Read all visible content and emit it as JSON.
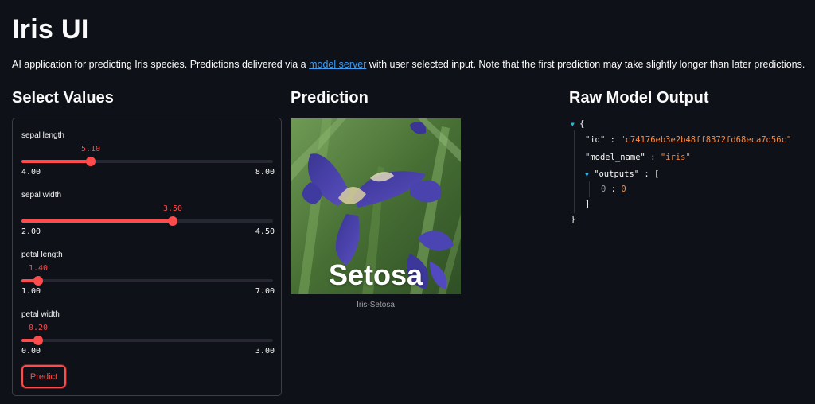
{
  "header": {
    "title": "Iris UI",
    "description_before": "AI application for predicting Iris species. Predictions delivered via a ",
    "description_link": "model server",
    "description_after": " with user selected input. Note that the first prediction may take slightly longer than later predictions."
  },
  "columns": {
    "select_values": "Select Values",
    "prediction": "Prediction",
    "raw_output": "Raw Model Output"
  },
  "sliders": [
    {
      "label": "sepal length",
      "value_text": "5.10",
      "value": 5.1,
      "min_text": "4.00",
      "max_text": "8.00",
      "min": 4.0,
      "max": 8.0
    },
    {
      "label": "sepal width",
      "value_text": "3.50",
      "value": 3.5,
      "min_text": "2.00",
      "max_text": "4.50",
      "min": 2.0,
      "max": 4.5
    },
    {
      "label": "petal length",
      "value_text": "1.40",
      "value": 1.4,
      "min_text": "1.00",
      "max_text": "7.00",
      "min": 1.0,
      "max": 7.0
    },
    {
      "label": "petal width",
      "value_text": "0.20",
      "value": 0.2,
      "min_text": "0.00",
      "max_text": "3.00",
      "min": 0.0,
      "max": 3.0
    }
  ],
  "predict_button": "Predict",
  "prediction": {
    "overlay_text": "Setosa",
    "caption": "Iris-Setosa"
  },
  "raw_output": {
    "open_brace": "{",
    "close_brace": "}",
    "id_key": "\"id\"",
    "id_value": "\"c74176eb3e2b48ff8372fd68eca7d56c\"",
    "model_name_key": "\"model_name\"",
    "model_name_value": "\"iris\"",
    "outputs_key": "\"outputs\"",
    "outputs_open": "[",
    "outputs_close": "]",
    "output_index": "0",
    "output_value": "0",
    "colon": ":"
  },
  "colors": {
    "background": "#0e1117",
    "accent": "#ff4b4b",
    "link": "#3d9df3",
    "json_string": "#ff8a3d",
    "caret": "#29b5e8"
  }
}
